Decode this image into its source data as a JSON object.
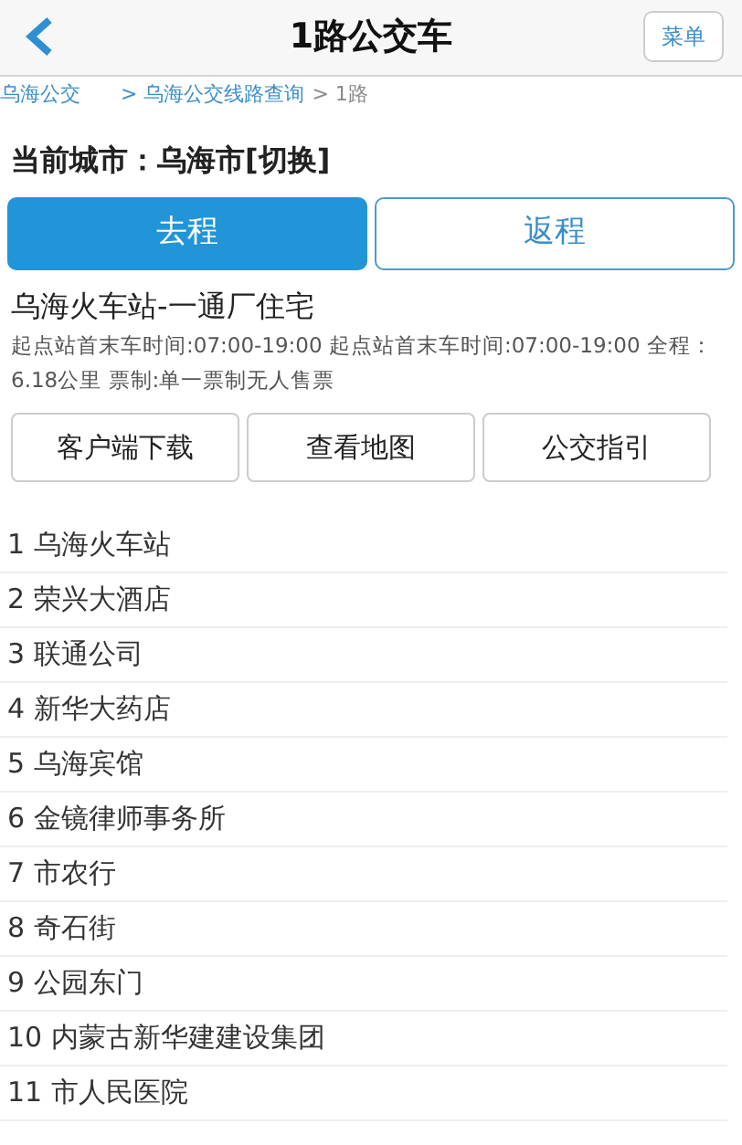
{
  "header": {
    "title": "1路公交车",
    "menu_button": "菜单"
  },
  "breadcrumb": [
    {
      "label": "乌海公交",
      "link": true
    },
    {
      "label": "> 乌海公交线路查询",
      "link": true
    },
    {
      "label": "> 1路",
      "link": false
    }
  ],
  "city_heading": "当前城市：乌海市[切换]",
  "direction_tabs": [
    {
      "label": "去程",
      "selected": true
    },
    {
      "label": "返程",
      "selected": false
    }
  ],
  "route": {
    "title": "乌海火车站-一通厂住宅",
    "info": "起点站首末车时间:07:00-19:00 起点站首末车时间:07:00-19:00 全程：6.18公里 票制:单一票制无人售票"
  },
  "actions": [
    "客户端下载",
    "查看地图",
    "公交指引"
  ],
  "stops": [
    "1 乌海火车站",
    "2 荣兴大酒店",
    "3 联通公司",
    "4 新华大药店",
    "5 乌海宾馆",
    "6 金镜律师事务所",
    "7 市农行",
    "8 奇石街",
    "9 公园东门",
    "10 内蒙古新华建建设集团",
    "11 市人民医院"
  ]
}
